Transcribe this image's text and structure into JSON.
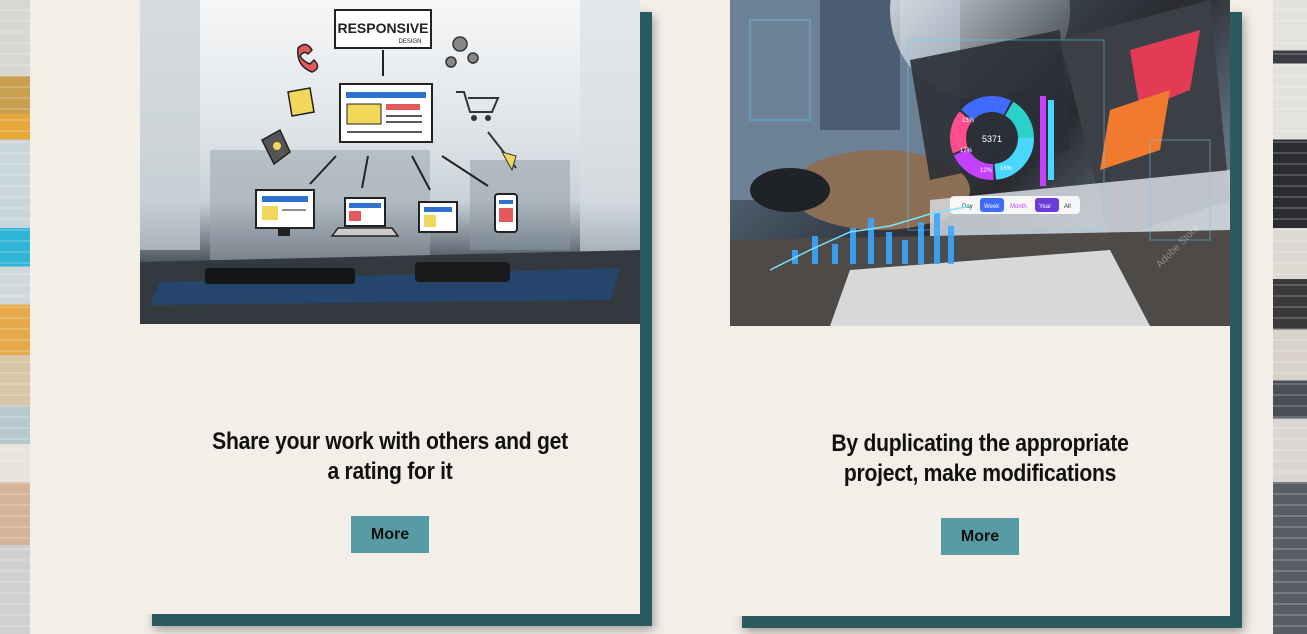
{
  "cards": [
    {
      "title": "Share your work with others and get a rating for it",
      "button_label": "More",
      "illustration_text": "RESPONSIVE",
      "illustration_subtext": "DESIGN"
    },
    {
      "title": "By duplicating the appropriate project, make modifications",
      "button_label": "More",
      "donut_value": "5371",
      "donut_percents": [
        "13%",
        "17%",
        "12%",
        "16%"
      ],
      "tabs": [
        "Day",
        "Week",
        "Month",
        "Year",
        "All"
      ],
      "watermark": "Adobe Stock"
    }
  ],
  "colors": {
    "page_bg": "#f3eee8",
    "button_bg": "#579ca4",
    "card_shadow": "#2b5b61"
  }
}
